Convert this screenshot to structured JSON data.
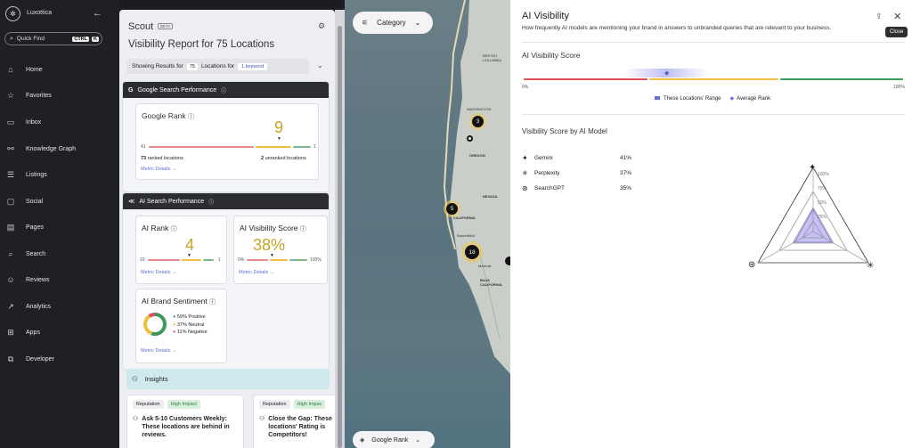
{
  "sidebar": {
    "brand": "Luxottica",
    "quick_find": "Quick Find",
    "shortcut_ctrl": "CTRL",
    "shortcut_key": "K",
    "items": [
      {
        "label": "Home",
        "icon": "home-icon"
      },
      {
        "label": "Favorites",
        "icon": "star-icon"
      },
      {
        "label": "Inbox",
        "icon": "inbox-icon"
      },
      {
        "label": "Knowledge Graph",
        "icon": "knowledge-graph-icon"
      },
      {
        "label": "Listings",
        "icon": "listings-icon"
      },
      {
        "label": "Social",
        "icon": "social-icon"
      },
      {
        "label": "Pages",
        "icon": "pages-icon"
      },
      {
        "label": "Search",
        "icon": "search-icon"
      },
      {
        "label": "Reviews",
        "icon": "reviews-icon"
      },
      {
        "label": "Analytics",
        "icon": "analytics-icon"
      },
      {
        "label": "Apps",
        "icon": "apps-icon"
      },
      {
        "label": "Developer",
        "icon": "developer-icon"
      }
    ]
  },
  "scout": {
    "title": "Scout",
    "badge": "BETA",
    "report_title": "Visibility Report for 75 Locations",
    "showing": "Showing Results for",
    "loc_count": "75",
    "locations_for": "Locations for",
    "keyword": "1 keyword"
  },
  "google": {
    "header": "Google Search Performance",
    "rank_title": "Google Rank",
    "rank_value": "9",
    "scale_min": "41",
    "scale_max": "1",
    "ranked": "73",
    "ranked_label": "ranked locations",
    "unranked": "2",
    "unranked_label": "unranked locations",
    "metric_details": "Metric Details"
  },
  "ai": {
    "header": "AI Search Performance",
    "rank_title": "AI Rank",
    "rank_value": "4",
    "rank_min": "10",
    "rank_max": "1",
    "vis_title": "AI Visibility Score",
    "vis_value": "38%",
    "vis_min": "0%",
    "vis_max": "100%",
    "metric_details": "Metric Details",
    "sentiment_title": "AI Brand Sentiment",
    "positive": "59% Positive",
    "neutral": "37% Neutral",
    "negative": "11% Negative",
    "sentiment_values": {
      "positive": 59,
      "neutral": 37,
      "negative": 11
    }
  },
  "insights": {
    "header": "Insights",
    "cards": [
      {
        "tag": "Reputation",
        "impact": "High Impact",
        "title": "Ask 5-10 Customers Weekly: These locations are behind in reviews."
      },
      {
        "tag": "Reputation",
        "impact": "High Impac",
        "title": "Close the Gap: These locations' Rating is Competitors!"
      }
    ]
  },
  "map": {
    "category_label": "Category",
    "metric_label": "Google Rank",
    "labels": [
      "BRITISH COLUMBIA",
      "WASHINGTON",
      "OREGON",
      "NEVADA",
      "CALIFORNIA",
      "Bakersfield",
      "Mexicali",
      "BAJA CALIFORNIA"
    ],
    "clusters": [
      "3",
      "5",
      "18"
    ]
  },
  "ai_visibility": {
    "title": "AI Visibility",
    "subtitle": "How frequently AI models are mentioning your brand in answers to unbranded queries that are relevant to your business.",
    "close_tooltip": "Close",
    "score_title": "AI Visibility Score",
    "axis_min": "0%",
    "axis_max": "100%",
    "legend_range": "These Locations' Range",
    "legend_avg": "Average Rank",
    "by_model_title": "Visibility Score by AI Model",
    "models": [
      {
        "name": "Gemini",
        "value": "41%",
        "icon": "gemini-icon"
      },
      {
        "name": "Perplexity",
        "value": "37%",
        "icon": "perplexity-icon"
      },
      {
        "name": "SearchGPT",
        "value": "35%",
        "icon": "searchgpt-icon"
      }
    ],
    "radar_ticks": [
      "100%",
      "75%",
      "50%",
      "25%"
    ]
  },
  "colors": {
    "accent": "#5b6fd6",
    "red": "#e0505a",
    "yellow": "#f0c040",
    "green": "#3c9a5a",
    "insight_bg": "#cfe9ec"
  }
}
